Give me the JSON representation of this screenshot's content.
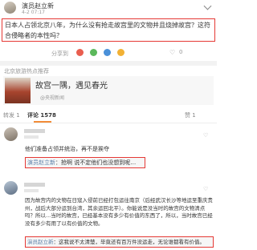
{
  "post": {
    "author": "演员赵立新",
    "time": "4-2 07:17",
    "body": "日本人占领北京八年，为什么没有抢走故宫里的文物并且烧掉故宫？这符合侵略者的本性吗？"
  },
  "actions": {
    "share_label": "分享到",
    "like_count": "0"
  },
  "card": {
    "title": "故宫一隅，遇见春光",
    "source": "@央视新闻",
    "recommend_label": "北京旅游热点推荐"
  },
  "tabs": {
    "forward": "转发 1",
    "comment": "评论 1578",
    "like": "赞 1"
  },
  "comments": [
    {
      "text": "他们准备占领并统治，再不是挨夺",
      "reply_author": "演员赵立新",
      "reply_text": "：抢啊 说不定他们也没想到呢…"
    },
    {
      "text": "因为故宫内的文物在日寇入侵前已经打包运往南京（后经武汉长沙等地运至重庆贵州，战后大部分运到台湾，其余运回北平）。你能说是没当时的故宫的文物清点吗？所以...当时的故宫，已经基本没有多少有价值的东西了，所以，当时故宫已经没有多少有用了以有价值的文物。",
      "reply_author": "演员赵立新",
      "reply_text": "：这我说不太清楚，毕竟还有百万件没运走，无论谁都看有价值。"
    }
  ],
  "colors": {
    "highlight": "#e53935",
    "link": "#5a7fa8",
    "tab_active": "#f28c38"
  }
}
